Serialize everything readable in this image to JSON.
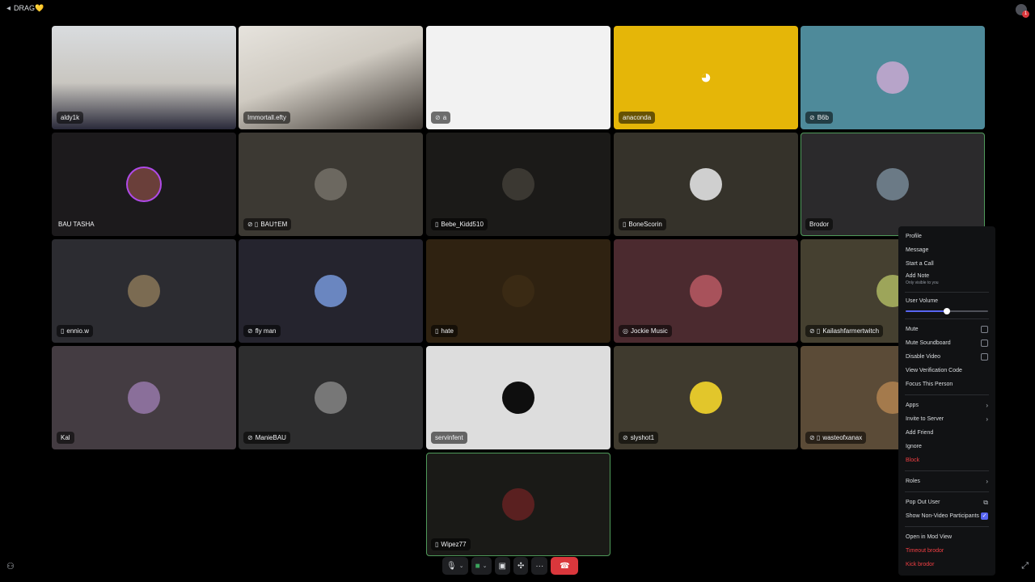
{
  "window": {
    "title": "DRAG💛",
    "inbox_count": "1"
  },
  "tiles": [
    {
      "name": "aldy1k",
      "icons": "",
      "kind": "camera"
    },
    {
      "name": "Immortall.efty",
      "icons": "",
      "kind": "camera"
    },
    {
      "name": "a",
      "icons": "⊘",
      "kind": "plain"
    },
    {
      "name": "anaconda",
      "icons": "",
      "kind": "plain"
    },
    {
      "name": "B6b",
      "icons": "⊘",
      "kind": "avatar"
    },
    {
      "name": "BAU TASHA",
      "icons": "",
      "kind": "avatar"
    },
    {
      "name": "BAU†EM",
      "icons": "⊘ ▯",
      "kind": "avatar"
    },
    {
      "name": "Bebe_Kidd510",
      "icons": "▯",
      "kind": "avatar"
    },
    {
      "name": "BoneScorin",
      "icons": "▯",
      "kind": "avatar"
    },
    {
      "name": "Brodor",
      "icons": "",
      "kind": "avatar"
    },
    {
      "name": "ennio.w",
      "icons": "▯",
      "kind": "avatar"
    },
    {
      "name": "fly man",
      "icons": "⊘",
      "kind": "avatar"
    },
    {
      "name": "hate",
      "icons": "▯",
      "kind": "avatar"
    },
    {
      "name": "Jockie Music",
      "icons": "◎",
      "kind": "avatar"
    },
    {
      "name": "Kailashfarmertwitch",
      "icons": "⊘ ▯",
      "kind": "avatar"
    },
    {
      "name": "Kal",
      "icons": "",
      "kind": "avatar"
    },
    {
      "name": "ManieBAU",
      "icons": "⊘",
      "kind": "avatar"
    },
    {
      "name": "servinfent",
      "icons": "",
      "kind": "avatar"
    },
    {
      "name": "slyshot1",
      "icons": "⊘",
      "kind": "avatar"
    },
    {
      "name": "wasteofxanax",
      "icons": "⊘ ▯",
      "kind": "avatar"
    },
    {
      "name": "Wipez77",
      "icons": "▯",
      "kind": "avatar"
    }
  ],
  "tile_colors": [
    "#c8c9cc",
    "#d3cfc8",
    "#f2f2f2",
    "#e5b608",
    "#4e8a9a",
    "#1c1a1c",
    "#3c3933",
    "#1b1a18",
    "#35322a",
    "#2b2a2c",
    "#2c2c31",
    "#25242e",
    "#2f2211",
    "#4b2a2f",
    "#454030",
    "#443c42",
    "#2d2d2e",
    "#dddddd",
    "#3f3a2e",
    "#5b4b37",
    "#1a1a17"
  ],
  "avatar_colors": [
    "",
    "",
    "",
    "",
    "#b7a4c9",
    "#6a3f3a",
    "#6c6860",
    "#3b3832",
    "#cfcfcf",
    "#6b7a86",
    "#7b6b52",
    "#6a86c0",
    "#3a2a14",
    "#a8525b",
    "#9da55a",
    "#8a6f9a",
    "#777777",
    "#0e0e0e",
    "#e2c62b",
    "#a47a4c",
    "#5a2020"
  ],
  "context_menu": {
    "profile": "Profile",
    "message": "Message",
    "start_call": "Start a Call",
    "add_note": "Add Note",
    "add_note_sub": "Only visible to you",
    "user_volume": "User Volume",
    "volume_fraction": 0.5,
    "mute": "Mute",
    "mute_soundboard": "Mute Soundboard",
    "disable_video": "Disable Video",
    "view_verification_code": "View Verification Code",
    "focus_person": "Focus This Person",
    "apps": "Apps",
    "invite_to_server": "Invite to Server",
    "add_friend": "Add Friend",
    "ignore": "Ignore",
    "block": "Block",
    "roles": "Roles",
    "pop_out_user": "Pop Out User",
    "show_non_video": "Show Non-Video Participants",
    "show_non_video_checked": true,
    "open_mod_view": "Open in Mod View",
    "timeout": "Timeout brodor",
    "kick": "Kick brodor"
  },
  "controls": {
    "mic_icon": "microphone-icon",
    "camera_icon": "camera-icon",
    "share_icon": "screen-share-icon",
    "activity_icon": "activity-icon",
    "more_icon": "more-icon",
    "leave_icon": "hang-up-icon"
  }
}
